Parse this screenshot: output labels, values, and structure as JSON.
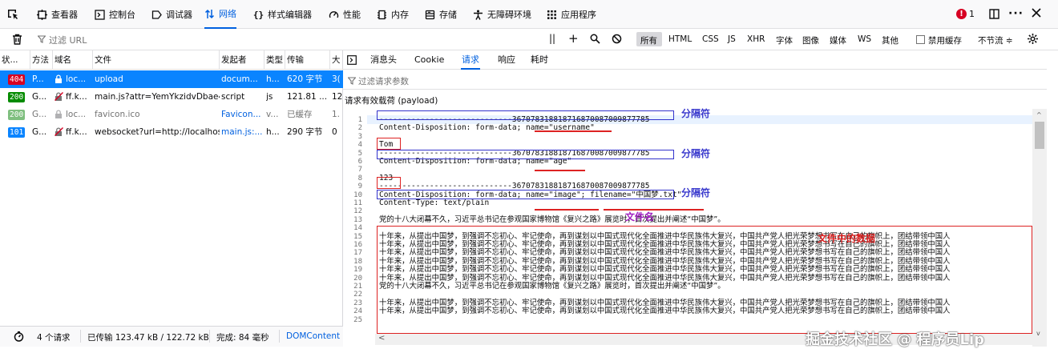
{
  "toolbar": {
    "tabs": [
      {
        "label": "查看器",
        "icon": "inspector-icon"
      },
      {
        "label": "控制台",
        "icon": "console-icon"
      },
      {
        "label": "调试器",
        "icon": "debugger-icon"
      },
      {
        "label": "网络",
        "icon": "network-icon"
      },
      {
        "label": "样式编辑器",
        "icon": "style-editor-icon"
      },
      {
        "label": "性能",
        "icon": "performance-icon"
      },
      {
        "label": "内存",
        "icon": "memory-icon"
      },
      {
        "label": "存储",
        "icon": "storage-icon"
      },
      {
        "label": "无障碍环境",
        "icon": "accessibility-icon"
      },
      {
        "label": "应用程序",
        "icon": "application-icon"
      }
    ],
    "error_count": "1",
    "active_color": "#0060df",
    "error_color": "#d70022"
  },
  "filterbar": {
    "filter_placeholder": "过滤 URL",
    "types": [
      "所有",
      "HTML",
      "CSS",
      "JS",
      "XHR",
      "字体",
      "图像",
      "媒体",
      "WS",
      "其他"
    ],
    "disable_cache_label": "禁用缓存",
    "throttle_label": "不节流 ≑"
  },
  "request_table": {
    "headers": [
      "状...",
      "方法",
      "域名",
      "文件",
      "发起者",
      "类型",
      "传输",
      "大"
    ],
    "rows": [
      {
        "status": "404",
        "status_color": "#d70022",
        "method": "P...",
        "domain": "loc...",
        "file": "upload",
        "initiator": "docum...",
        "type": "h...",
        "transferred": "620 字节",
        "size": "3("
      },
      {
        "status": "200",
        "status_color": "#058b00",
        "method": "G...",
        "domain": "ff.k...",
        "file": "main.js?attr=YemYkzidvDbae4",
        "initiator": "script",
        "type": "js",
        "transferred": "121.81 ...",
        "size": "12"
      },
      {
        "status": "200",
        "status_color": "#7fbf7f",
        "method": "G...",
        "domain": "loc...",
        "file": "favicon.ico",
        "initiator": "Favicon...",
        "type": "v...",
        "transferred": "已缓存",
        "size": "1."
      },
      {
        "status": "101",
        "status_color": "#0a84ff",
        "method": "G...",
        "domain": "ff.k...",
        "file": "websocket?url=http://localhos",
        "initiator": "main.js:...",
        "type": "h...",
        "transferred": "290 字节",
        "size": "0"
      }
    ]
  },
  "statusbar": {
    "requests": "4 个请求",
    "transferred": "已传输 123.47 kB / 122.72 kB",
    "finish": "完成: 84 毫秒",
    "dom": "DOMContent"
  },
  "details": {
    "tabs": [
      "消息头",
      "Cookie",
      "请求",
      "响应",
      "耗时"
    ],
    "filter_placeholder": "过滤请求参数",
    "payload_title": "请求有效载荷 (payload)",
    "lines": [
      "-----------------------------367078318818716870087009877785",
      "Content-Disposition: form-data; name=\"username\"",
      "",
      "Tom",
      "-----------------------------367078318818716870087009877785",
      "Content-Disposition: form-data; name=\"age\"",
      "",
      "123",
      "-----------------------------367078318818716870087009877785",
      "Content-Disposition: form-data; name=\"image\"; filename=\"中国梦.txt\"",
      "Content-Type: text/plain",
      "",
      "党的十八大闭幕不久，习近平总书记在参观国家博物馆《复兴之路》展览时，首次提出并阐述“中国梦”。",
      "",
      "十年来，从提出中国梦，到强调不忘初心、牢记使命，再到谋划以中国式现代化全面推进中华民族伟大复兴，中国共产党人把光荣梦想书写在自己的旗帜上，团结带领中国人",
      "十年来，从提出中国梦，到强调不忘初心、牢记使命，再到谋划以中国式现代化全面推进中华民族伟大复兴，中国共产党人把光荣梦想书写在自己的旗帜上，团结带领中国人",
      "十年来，从提出中国梦，到强调不忘初心、牢记使命，再到谋划以中国式现代化全面推进中华民族伟大复兴，中国共产党人把光荣梦想书写在自己的旗帜上，团结带领中国人",
      "十年来，从提出中国梦，到强调不忘初心、牢记使命，再到谋划以中国式现代化全面推进中华民族伟大复兴，中国共产党人把光荣梦想书写在自己的旗帜上，团结带领中国人",
      "十年来，从提出中国梦，到强调不忘初心、牢记使命，再到谋划以中国式现代化全面推进中华民族伟大复兴，中国共产党人把光荣梦想书写在自己的旗帜上，团结带领中国人",
      "十年来，从提出中国梦，到强调不忘初心、牢记使命，再到谋划以中国式现代化全面推进中华民族伟大复兴，中国共产党人把光荣梦想书写在自己的旗帜上，团结带领中国人",
      "党的十八大闭幕不久，习近平总书记在参观国家博物馆《复兴之路》展览时，首次提出并阐述“中国梦”。",
      "",
      "十年来，从提出中国梦，到强调不忘初心、牢记使命，再到谋划以中国式现代化全面推进中华民族伟大复兴，中国共产党人把光荣梦想书写在自己的旗帜上，团结带领中国人",
      "十年来，从提出中国梦，到强调不忘初心、牢记使命，再到谋划以中国式现代化全面推进中华民族伟大复兴，中国共产党人把光荣梦想书写在自己的旗帜上，团结带领中国人",
      ""
    ]
  },
  "annotations": {
    "separator": "分隔符",
    "filename": "文件名",
    "file_data": "文件中的数据",
    "annotation_color": "#3a3acd",
    "box_red": "#dd2222",
    "box_blue": "#3333cc"
  },
  "watermark": "掘金技术社区 @ 程序员Lip"
}
